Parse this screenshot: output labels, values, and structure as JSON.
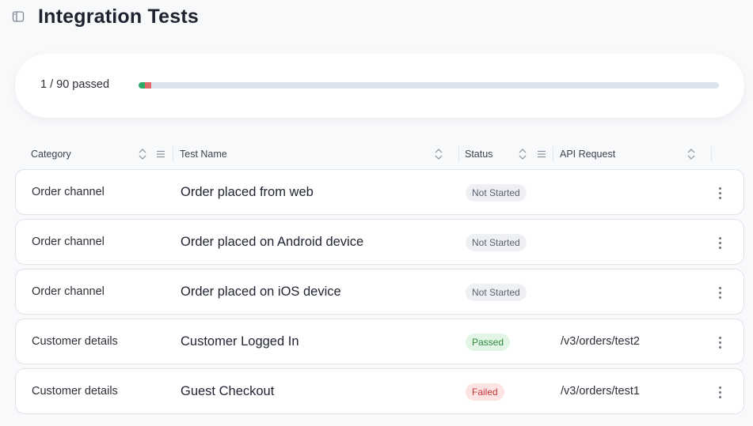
{
  "page": {
    "title": "Integration Tests"
  },
  "progress": {
    "label": "1 / 90 passed",
    "passed": 1,
    "failed": 1,
    "total": 90,
    "colors": {
      "passed": "#2fa866",
      "failed": "#e06a6a",
      "track": "#dce3ef"
    }
  },
  "table": {
    "columns": {
      "category": "Category",
      "test_name": "Test Name",
      "status": "Status",
      "api_request": "API Request"
    },
    "rows": [
      {
        "category": "Order channel",
        "name": "Order placed from web",
        "status": "Not Started",
        "status_type": "not-started",
        "api": ""
      },
      {
        "category": "Order channel",
        "name": "Order placed on Android device",
        "status": "Not Started",
        "status_type": "not-started",
        "api": ""
      },
      {
        "category": "Order channel",
        "name": "Order placed on iOS device",
        "status": "Not Started",
        "status_type": "not-started",
        "api": ""
      },
      {
        "category": "Customer details",
        "name": "Customer Logged In",
        "status": "Passed",
        "status_type": "passed",
        "api": "/v3/orders/test2"
      },
      {
        "category": "Customer details",
        "name": "Guest Checkout",
        "status": "Failed",
        "status_type": "failed",
        "api": "/v3/orders/test1"
      }
    ]
  },
  "icons": {
    "sidebar_toggle": "sidebar-panel-icon",
    "sort": "sort-icon",
    "column_menu": "column-menu-icon",
    "row_menu": "kebab-menu-icon"
  }
}
